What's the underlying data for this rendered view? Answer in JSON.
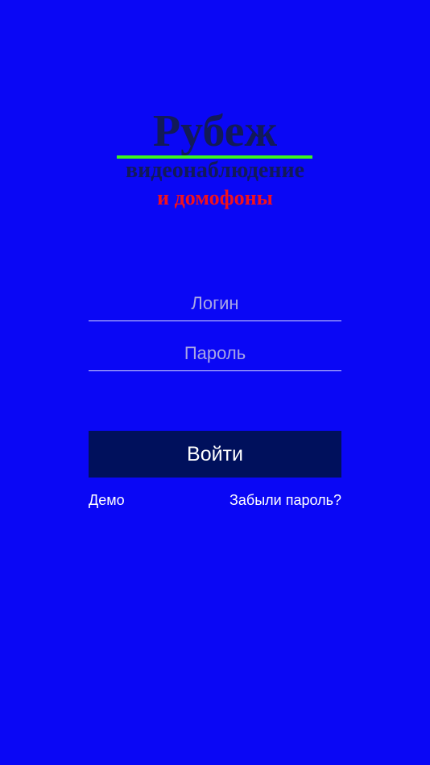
{
  "logo": {
    "title": "Рубеж",
    "subtitle": "видеонаблюдение",
    "tagline": "и домофоны"
  },
  "form": {
    "login_placeholder": "Логин",
    "login_value": "",
    "password_placeholder": "Пароль",
    "password_value": "",
    "submit_label": "Войти"
  },
  "links": {
    "demo": "Демо",
    "forgot_password": "Забыли пароль?"
  },
  "colors": {
    "background": "#0a07f5",
    "logo_text": "#121a58",
    "underline": "#3cf51e",
    "tagline": "#f0101f",
    "button": "#00105c"
  }
}
